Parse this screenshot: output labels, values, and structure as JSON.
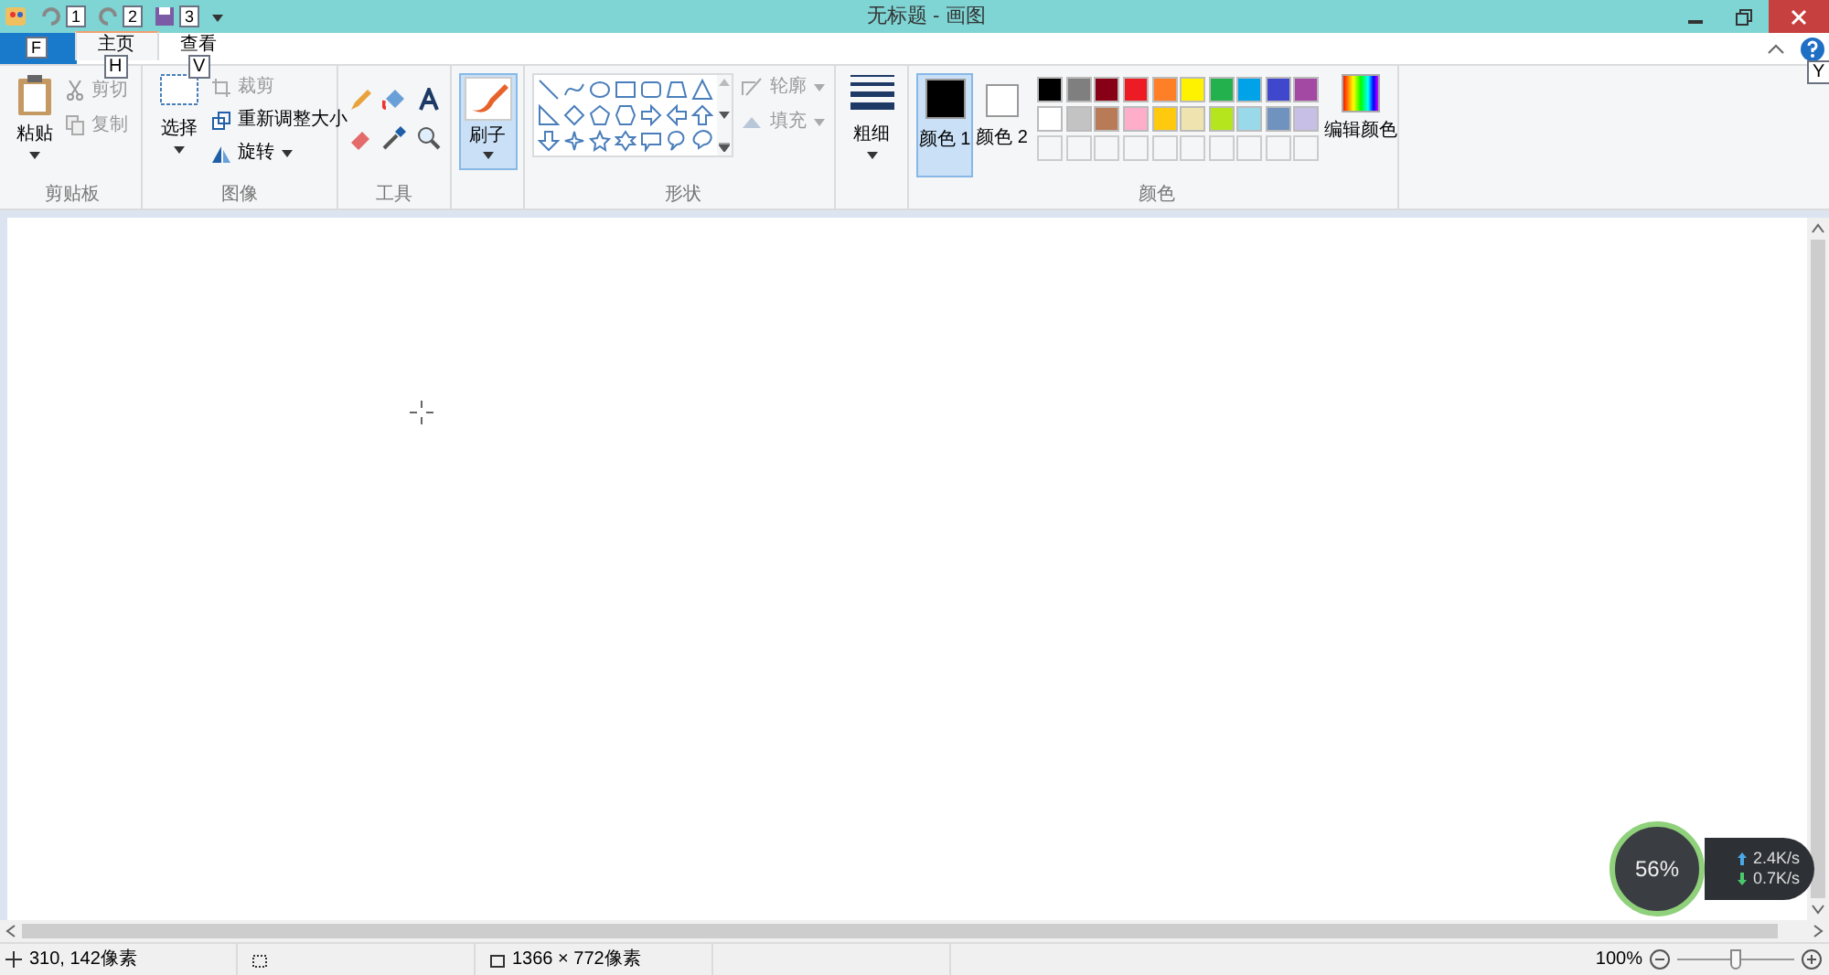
{
  "window": {
    "title": "无标题 - 画图"
  },
  "quick_access": {
    "keytips": [
      "1",
      "2",
      "3"
    ]
  },
  "file_tab": {
    "keytip": "F"
  },
  "tabs": [
    {
      "label": "主页",
      "keytip": "H",
      "selected": true
    },
    {
      "label": "查看",
      "keytip": "V",
      "selected": false
    }
  ],
  "help_keytip": "Y",
  "groups": {
    "clipboard": {
      "title": "剪贴板",
      "paste": "粘贴",
      "cut": "剪切",
      "copy": "复制"
    },
    "image": {
      "title": "图像",
      "select": "选择",
      "crop": "裁剪",
      "resize": "重新调整大小",
      "rotate": "旋转"
    },
    "tools": {
      "title": "工具"
    },
    "brushes": {
      "label": "刷子",
      "selected": true
    },
    "shapes": {
      "title": "形状",
      "outline": "轮廓",
      "fill": "填充"
    },
    "size": {
      "label": "粗细"
    },
    "colors": {
      "title": "颜色",
      "color1": {
        "label": "颜色 1",
        "selected": true,
        "color": "#000000"
      },
      "color2": {
        "label": "颜色 2",
        "selected": false,
        "color": "#ffffff"
      },
      "palette": [
        {
          "color": "#000000"
        },
        {
          "color": "#7f7f7f"
        },
        {
          "color": "#880015"
        },
        {
          "color": "#ed1c24"
        },
        {
          "color": "#ff7f27"
        },
        {
          "color": "#fff200"
        },
        {
          "color": "#22b14c"
        },
        {
          "color": "#00a2e8"
        },
        {
          "color": "#3f48cc"
        },
        {
          "color": "#a349a4"
        },
        {
          "color": "#ffffff"
        },
        {
          "color": "#c3c3c3"
        },
        {
          "color": "#b97a57"
        },
        {
          "color": "#ffaec9"
        },
        {
          "color": "#ffc90e"
        },
        {
          "color": "#efe4b0"
        },
        {
          "color": "#b5e61d"
        },
        {
          "color": "#99d9ea"
        },
        {
          "color": "#7092be"
        },
        {
          "color": "#c8bfe7"
        }
      ],
      "edit": "编辑颜色"
    }
  },
  "speed_widget": {
    "percent": "56%",
    "up": "2.4K/s",
    "down": "0.7K/s"
  },
  "status_bar": {
    "position": "310, 142像素",
    "size": "1366 × 772像素",
    "zoom": "100%",
    "zoom_slider": {
      "level": 0.5
    }
  }
}
